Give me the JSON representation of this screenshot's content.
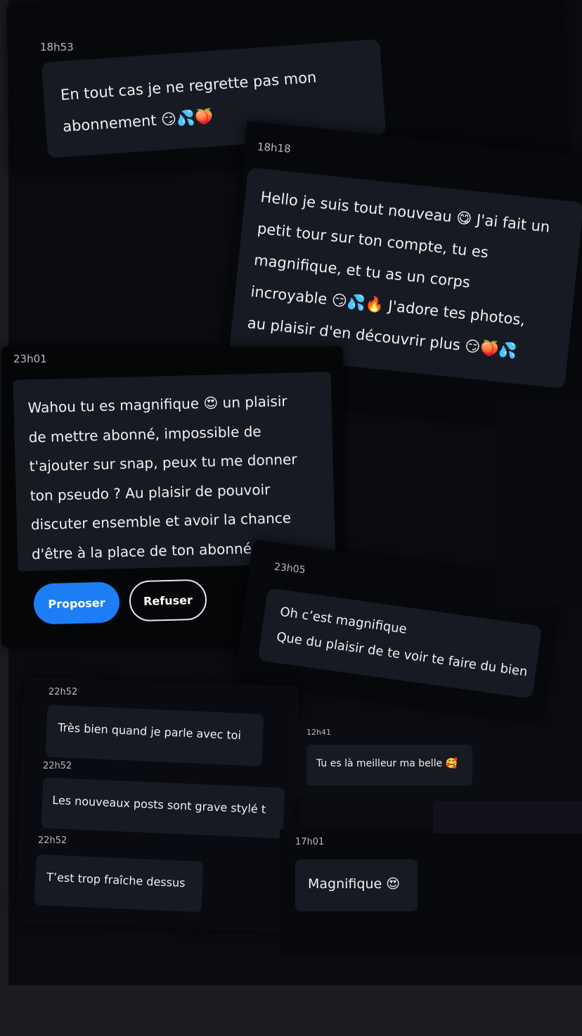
{
  "messages": {
    "m1": {
      "time": "18h53",
      "text": "En tout cas je ne regrette pas mon\nabonnement 😏💦🍑"
    },
    "m2": {
      "time": "18h18",
      "text": "Hello je suis tout nouveau 😋 J'ai fait un\npetit tour sur ton compte, tu es\nmagnifique, et tu as un corps\nincroyable 😏💦🔥 J'adore tes photos,\nau plaisir d'en découvrir plus 😏🍑💦"
    },
    "m3": {
      "time": "23h01",
      "text": "Wahou tu es magnifique 😍 un plaisir\nde mettre abonné, impossible de\nt'ajouter sur snap, peux tu me donner\nton pseudo ? Au plaisir de pouvoir\ndiscuter ensemble et avoir la chance\nd'être à la place de ton abonné 😉"
    },
    "m4": {
      "time": "23h05",
      "text": "Oh c’est magnifique\nQue du plaisir de te voir te faire du bien"
    },
    "m5": {
      "time": "22h52",
      "text": "Très bien quand je parle avec toi"
    },
    "m6": {
      "time": "22h52",
      "text": "Les nouveaux posts sont grave stylé t"
    },
    "m7": {
      "time": "22h52",
      "text": "T’est trop fraîche dessus"
    },
    "m8": {
      "time": "12h41",
      "text": "Tu es là meilleur ma belle 🥰"
    },
    "m9": {
      "time": "17h01",
      "text": "Magnifique 😍"
    }
  },
  "actions": {
    "propose_label": "Proposer",
    "refuse_label": "Refuser"
  },
  "colors": {
    "accent": "#1d7df5",
    "bubble": "#171a22",
    "background": "#08090d"
  }
}
